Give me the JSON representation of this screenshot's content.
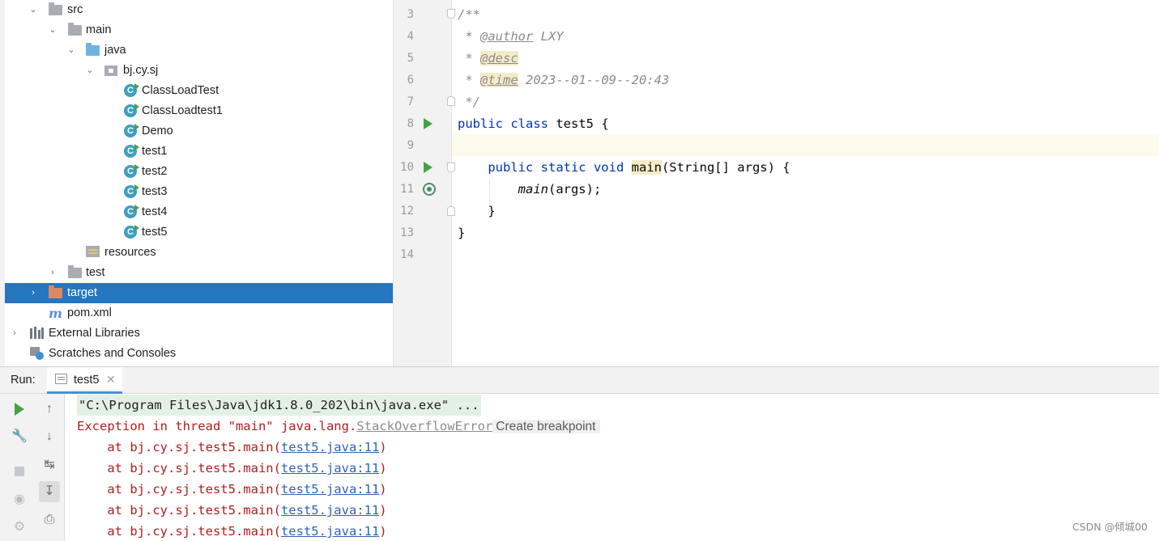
{
  "project_tree": {
    "items": [
      {
        "label": "src",
        "icon": "folder-icon"
      },
      {
        "label": "main",
        "icon": "folder-icon"
      },
      {
        "label": "java",
        "icon": "source-folder-icon"
      },
      {
        "label": "bj.cy.sj",
        "icon": "package-icon"
      },
      {
        "label": "ClassLoadTest",
        "icon": "java-class-icon"
      },
      {
        "label": "ClassLoadtest1",
        "icon": "java-class-icon"
      },
      {
        "label": "Demo",
        "icon": "java-class-icon"
      },
      {
        "label": "test1",
        "icon": "java-class-icon"
      },
      {
        "label": "test2",
        "icon": "java-class-icon"
      },
      {
        "label": "test3",
        "icon": "java-class-icon"
      },
      {
        "label": "test4",
        "icon": "java-class-icon"
      },
      {
        "label": "test5",
        "icon": "java-class-icon"
      },
      {
        "label": "resources",
        "icon": "resources-folder-icon"
      },
      {
        "label": "test",
        "icon": "folder-icon"
      },
      {
        "label": "target",
        "icon": "excluded-folder-icon",
        "selected": true
      },
      {
        "label": "pom.xml",
        "icon": "maven-icon"
      },
      {
        "label": "External Libraries",
        "icon": "libraries-icon"
      },
      {
        "label": "Scratches and Consoles",
        "icon": "scratches-icon"
      }
    ]
  },
  "editor": {
    "line_numbers": [
      "3",
      "4",
      "5",
      "6",
      "7",
      "8",
      "9",
      "10",
      "11",
      "12",
      "13",
      "14"
    ],
    "code": {
      "l3": "/**",
      "l4_prefix": " * ",
      "l4_tag": "@author",
      "l4_text": " LXY",
      "l5_prefix": " * ",
      "l5_tag": "@desc",
      "l6_prefix": " * ",
      "l6_tag": "@time",
      "l6_text": " 2023--01--09--20:43",
      "l7": " */",
      "l8_kw": "public class ",
      "l8_name": "test5",
      "l8_rest": " {",
      "l10_kw": "    public static void ",
      "l10_method": "main",
      "l10_rest": "(String[] args) {",
      "l11_indent": "        ",
      "l11_call": "main",
      "l11_rest": "(args);",
      "l12": "    }",
      "l13": "}"
    }
  },
  "run_panel": {
    "label": "Run:",
    "tab_label": "test5",
    "tab_close": "✕",
    "console": {
      "command": "\"C:\\Program Files\\Java\\jdk1.8.0_202\\bin\\java.exe\" ...",
      "exception_prefix": "Exception in thread \"main\" java.lang.",
      "exception_class": "StackOverflowError",
      "breakpoint_hint": "Create breakpoint",
      "trace_prefix": "    at bj.cy.sj.test5.main(",
      "trace_link": "test5.java:11",
      "trace_suffix": ")"
    }
  },
  "watermark": "CSDN @倾城00"
}
